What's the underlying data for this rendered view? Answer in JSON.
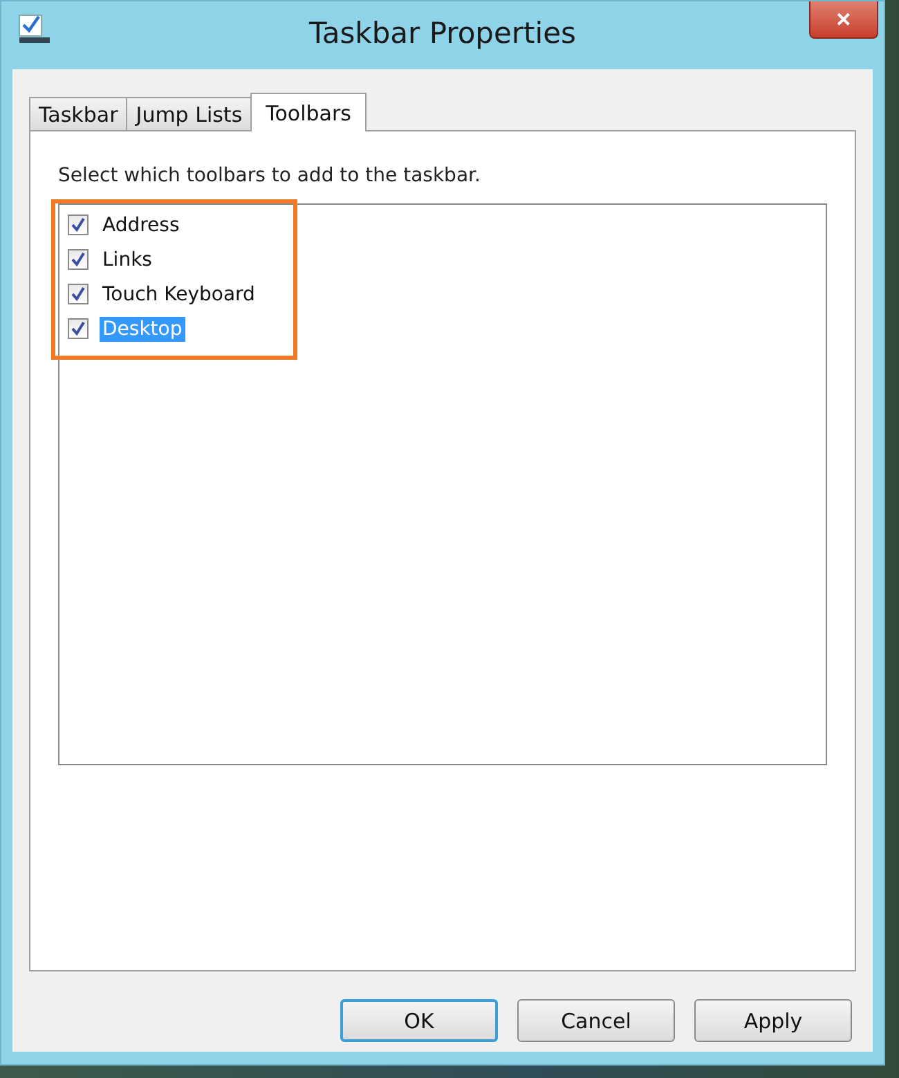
{
  "window": {
    "title": "Taskbar Properties",
    "close": "✕"
  },
  "tabs": [
    {
      "label": "Taskbar",
      "selected": false
    },
    {
      "label": "Jump Lists",
      "selected": false
    },
    {
      "label": "Toolbars",
      "selected": true
    }
  ],
  "instruction": "Select which toolbars to add to the taskbar.",
  "toolbars": [
    {
      "label": "Address",
      "checked": true,
      "selected": false
    },
    {
      "label": "Links",
      "checked": true,
      "selected": false
    },
    {
      "label": "Touch Keyboard",
      "checked": true,
      "selected": false
    },
    {
      "label": "Desktop",
      "checked": true,
      "selected": true
    }
  ],
  "buttons": [
    {
      "label": "OK",
      "default": true
    },
    {
      "label": "Cancel",
      "default": false
    },
    {
      "label": "Apply",
      "default": false
    }
  ]
}
